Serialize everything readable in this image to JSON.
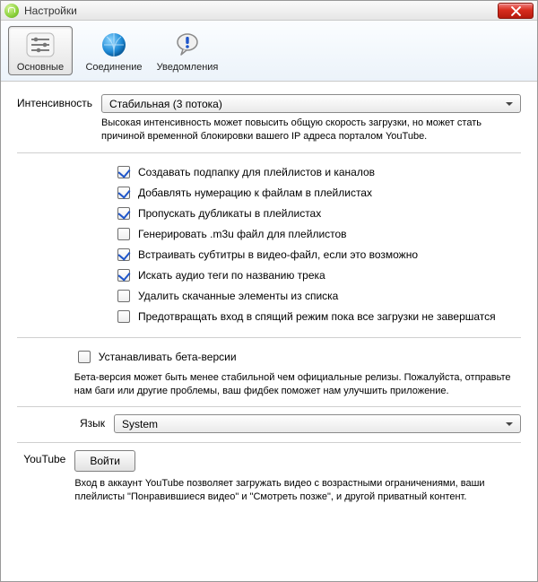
{
  "window": {
    "title": "Настройки"
  },
  "tabs": {
    "general": "Основные",
    "connection": "Соединение",
    "notifications": "Уведомления"
  },
  "intensity": {
    "label": "Интенсивность",
    "value": "Стабильная (3 потока)",
    "hint": "Высокая интенсивность может повысить общую скорость загрузки, но может стать причиной временной блокировки вашего IP адреса порталом YouTube."
  },
  "options": [
    {
      "label": "Создавать подпапку для плейлистов и каналов",
      "checked": true
    },
    {
      "label": "Добавлять нумерацию к файлам в плейлистах",
      "checked": true
    },
    {
      "label": "Пропускать дубликаты в плейлистах",
      "checked": true
    },
    {
      "label": "Генерировать .m3u файл для плейлистов",
      "checked": false
    },
    {
      "label": "Встраивать субтитры в видео-файл, если это возможно",
      "checked": true
    },
    {
      "label": "Искать аудио теги по названию трека",
      "checked": true
    },
    {
      "label": "Удалить скачанные элементы из списка",
      "checked": false
    },
    {
      "label": "Предотвращать вход в спящий режим пока все загрузки не завершатся",
      "checked": false
    }
  ],
  "beta": {
    "label": "Устанавливать бета-версии",
    "checked": false,
    "hint": "Бета-версия может быть менее стабильной чем официальные релизы.  Пожалуйста, отправьте нам баги или другие проблемы, ваш фидбек поможет нам улучшить приложение."
  },
  "language": {
    "label": "Язык",
    "value": "System"
  },
  "youtube": {
    "label": "YouTube",
    "button": "Войти",
    "hint": "Вход в аккаунт YouTube позволяет загружать видео с возрастными ограничениями, ваши плейлисты \"Понравившиеся видео\" и \"Смотреть позже\", и другой приватный контент."
  }
}
